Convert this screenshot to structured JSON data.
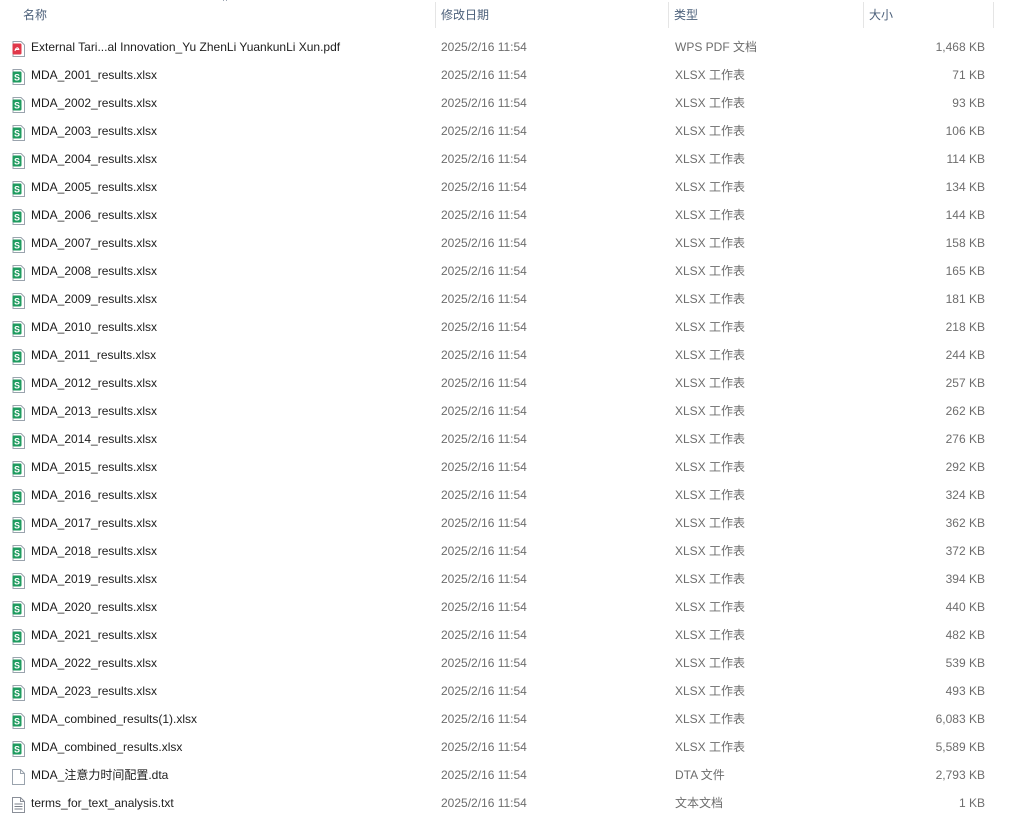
{
  "columns": {
    "name": "名称",
    "date": "修改日期",
    "type": "类型",
    "size": "大小"
  },
  "icon_colors": {
    "xlsx": "#1f9b5f",
    "pdf": "#e0384a",
    "txt": "#8a8f98",
    "dta": "#ffffff"
  },
  "files": [
    {
      "name": "External Tari...al Innovation_Yu ZhenLi YuankunLi Xun.pdf",
      "date": "2025/2/16 11:54",
      "type": "WPS PDF 文档",
      "size": "1,468 KB",
      "icon": "pdf-icon",
      "kind": "pdf"
    },
    {
      "name": "MDA_2001_results.xlsx",
      "date": "2025/2/16 11:54",
      "type": "XLSX 工作表",
      "size": "71 KB",
      "icon": "xlsx-icon",
      "kind": "xlsx"
    },
    {
      "name": "MDA_2002_results.xlsx",
      "date": "2025/2/16 11:54",
      "type": "XLSX 工作表",
      "size": "93 KB",
      "icon": "xlsx-icon",
      "kind": "xlsx"
    },
    {
      "name": "MDA_2003_results.xlsx",
      "date": "2025/2/16 11:54",
      "type": "XLSX 工作表",
      "size": "106 KB",
      "icon": "xlsx-icon",
      "kind": "xlsx"
    },
    {
      "name": "MDA_2004_results.xlsx",
      "date": "2025/2/16 11:54",
      "type": "XLSX 工作表",
      "size": "114 KB",
      "icon": "xlsx-icon",
      "kind": "xlsx"
    },
    {
      "name": "MDA_2005_results.xlsx",
      "date": "2025/2/16 11:54",
      "type": "XLSX 工作表",
      "size": "134 KB",
      "icon": "xlsx-icon",
      "kind": "xlsx"
    },
    {
      "name": "MDA_2006_results.xlsx",
      "date": "2025/2/16 11:54",
      "type": "XLSX 工作表",
      "size": "144 KB",
      "icon": "xlsx-icon",
      "kind": "xlsx"
    },
    {
      "name": "MDA_2007_results.xlsx",
      "date": "2025/2/16 11:54",
      "type": "XLSX 工作表",
      "size": "158 KB",
      "icon": "xlsx-icon",
      "kind": "xlsx"
    },
    {
      "name": "MDA_2008_results.xlsx",
      "date": "2025/2/16 11:54",
      "type": "XLSX 工作表",
      "size": "165 KB",
      "icon": "xlsx-icon",
      "kind": "xlsx"
    },
    {
      "name": "MDA_2009_results.xlsx",
      "date": "2025/2/16 11:54",
      "type": "XLSX 工作表",
      "size": "181 KB",
      "icon": "xlsx-icon",
      "kind": "xlsx"
    },
    {
      "name": "MDA_2010_results.xlsx",
      "date": "2025/2/16 11:54",
      "type": "XLSX 工作表",
      "size": "218 KB",
      "icon": "xlsx-icon",
      "kind": "xlsx"
    },
    {
      "name": "MDA_2011_results.xlsx",
      "date": "2025/2/16 11:54",
      "type": "XLSX 工作表",
      "size": "244 KB",
      "icon": "xlsx-icon",
      "kind": "xlsx"
    },
    {
      "name": "MDA_2012_results.xlsx",
      "date": "2025/2/16 11:54",
      "type": "XLSX 工作表",
      "size": "257 KB",
      "icon": "xlsx-icon",
      "kind": "xlsx"
    },
    {
      "name": "MDA_2013_results.xlsx",
      "date": "2025/2/16 11:54",
      "type": "XLSX 工作表",
      "size": "262 KB",
      "icon": "xlsx-icon",
      "kind": "xlsx"
    },
    {
      "name": "MDA_2014_results.xlsx",
      "date": "2025/2/16 11:54",
      "type": "XLSX 工作表",
      "size": "276 KB",
      "icon": "xlsx-icon",
      "kind": "xlsx"
    },
    {
      "name": "MDA_2015_results.xlsx",
      "date": "2025/2/16 11:54",
      "type": "XLSX 工作表",
      "size": "292 KB",
      "icon": "xlsx-icon",
      "kind": "xlsx"
    },
    {
      "name": "MDA_2016_results.xlsx",
      "date": "2025/2/16 11:54",
      "type": "XLSX 工作表",
      "size": "324 KB",
      "icon": "xlsx-icon",
      "kind": "xlsx"
    },
    {
      "name": "MDA_2017_results.xlsx",
      "date": "2025/2/16 11:54",
      "type": "XLSX 工作表",
      "size": "362 KB",
      "icon": "xlsx-icon",
      "kind": "xlsx"
    },
    {
      "name": "MDA_2018_results.xlsx",
      "date": "2025/2/16 11:54",
      "type": "XLSX 工作表",
      "size": "372 KB",
      "icon": "xlsx-icon",
      "kind": "xlsx"
    },
    {
      "name": "MDA_2019_results.xlsx",
      "date": "2025/2/16 11:54",
      "type": "XLSX 工作表",
      "size": "394 KB",
      "icon": "xlsx-icon",
      "kind": "xlsx"
    },
    {
      "name": "MDA_2020_results.xlsx",
      "date": "2025/2/16 11:54",
      "type": "XLSX 工作表",
      "size": "440 KB",
      "icon": "xlsx-icon",
      "kind": "xlsx"
    },
    {
      "name": "MDA_2021_results.xlsx",
      "date": "2025/2/16 11:54",
      "type": "XLSX 工作表",
      "size": "482 KB",
      "icon": "xlsx-icon",
      "kind": "xlsx"
    },
    {
      "name": "MDA_2022_results.xlsx",
      "date": "2025/2/16 11:54",
      "type": "XLSX 工作表",
      "size": "539 KB",
      "icon": "xlsx-icon",
      "kind": "xlsx"
    },
    {
      "name": "MDA_2023_results.xlsx",
      "date": "2025/2/16 11:54",
      "type": "XLSX 工作表",
      "size": "493 KB",
      "icon": "xlsx-icon",
      "kind": "xlsx"
    },
    {
      "name": "MDA_combined_results(1).xlsx",
      "date": "2025/2/16 11:54",
      "type": "XLSX 工作表",
      "size": "6,083 KB",
      "icon": "xlsx-icon",
      "kind": "xlsx"
    },
    {
      "name": "MDA_combined_results.xlsx",
      "date": "2025/2/16 11:54",
      "type": "XLSX 工作表",
      "size": "5,589 KB",
      "icon": "xlsx-icon",
      "kind": "xlsx"
    },
    {
      "name": "MDA_注意力时间配置.dta",
      "date": "2025/2/16 11:54",
      "type": "DTA 文件",
      "size": "2,793 KB",
      "icon": "file-icon",
      "kind": "dta"
    },
    {
      "name": "terms_for_text_analysis.txt",
      "date": "2025/2/16 11:54",
      "type": "文本文档",
      "size": "1 KB",
      "icon": "text-file-icon",
      "kind": "txt"
    }
  ]
}
